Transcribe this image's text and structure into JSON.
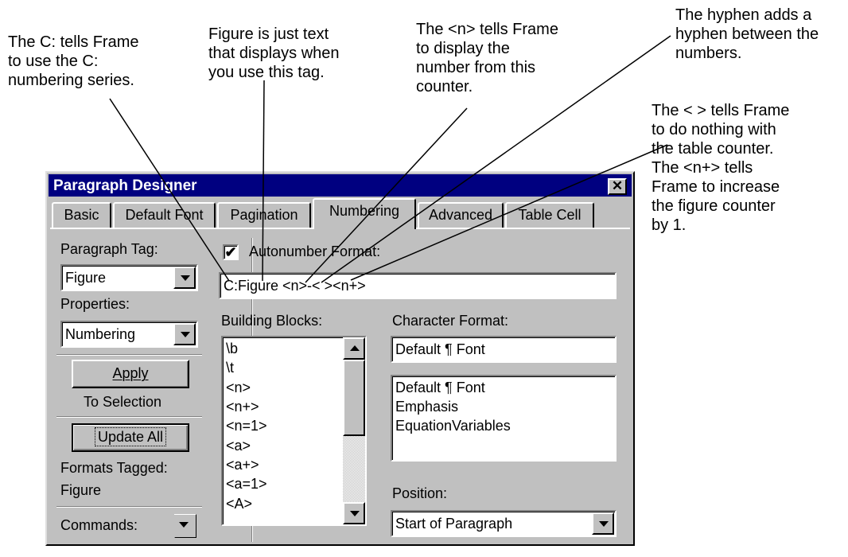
{
  "callouts": {
    "c_tag": "The C: tells Frame\nto use the C:\nnumbering series.",
    "figure_text": "Figure is just text\nthat displays when\nyou use this tag.",
    "n_tag": "The <n> tells Frame\nto display the\nnumber from this\ncounter.",
    "hyphen": "The hyphen adds a\nhyphen between the\nnumbers.",
    "table_counter": "The < > tells Frame\nto do nothing with\nthe table counter.\nThe <n+> tells\nFrame to increase\nthe figure counter\nby 1."
  },
  "dialog": {
    "title": "Paragraph Designer",
    "close": "✕",
    "tabs": [
      "Basic",
      "Default Font",
      "Pagination",
      "Numbering",
      "Advanced",
      "Table Cell"
    ],
    "active_tab": "Numbering"
  },
  "left": {
    "paragraph_tag_label": "Paragraph Tag:",
    "paragraph_tag_value": "Figure",
    "properties_label": "Properties:",
    "properties_value": "Numbering",
    "apply_button": "Apply",
    "to_selection": "To Selection",
    "update_all_button": "Update All",
    "formats_tagged_label": "Formats Tagged:",
    "formats_tagged_value": "Figure",
    "commands_label": "Commands:"
  },
  "right": {
    "autonumber_checked": true,
    "autonumber_label": "Autonumber Format:",
    "autonumber_value": "C:Figure <n>-< ><n+>",
    "building_blocks_label": "Building Blocks:",
    "building_blocks": [
      "\\b",
      "\\t",
      "<n>",
      "<n+>",
      "<n=1>",
      "<a>",
      "<a+>",
      "<a=1>",
      "<A>"
    ],
    "character_format_label": "Character Format:",
    "character_format_value": "Default ¶ Font",
    "character_formats": [
      "Default ¶ Font",
      "Emphasis",
      "EquationVariables"
    ],
    "position_label": "Position:",
    "position_value": "Start of Paragraph"
  }
}
